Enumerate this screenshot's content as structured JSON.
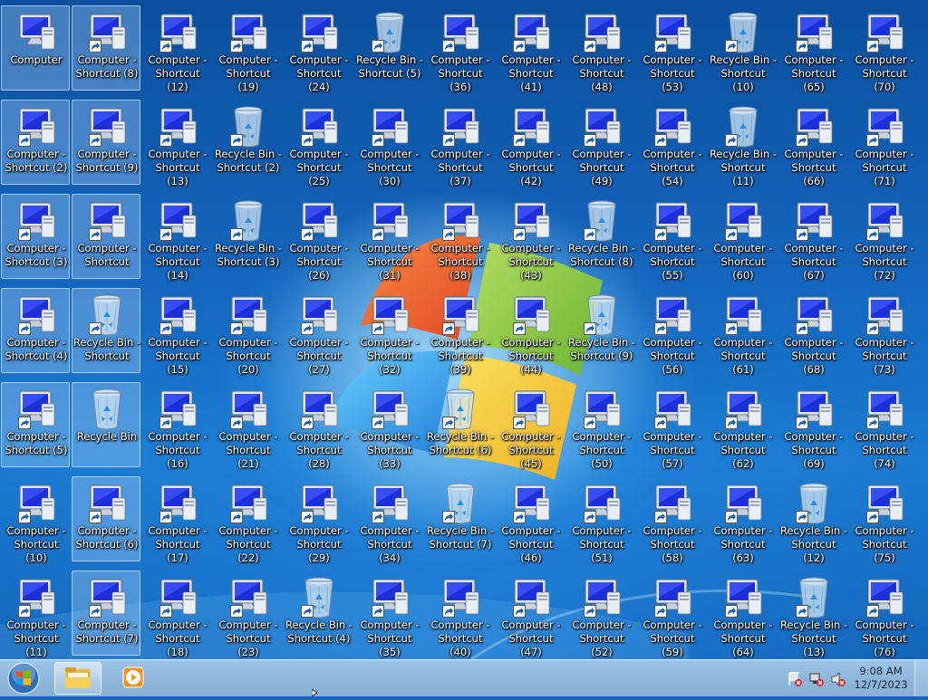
{
  "desktop": {
    "columns": [
      [
        {
          "label": "Computer",
          "icon": "computer-icon",
          "shortcut": false,
          "selected": true
        },
        {
          "label": "Computer - Shortcut (2)",
          "icon": "computer-icon",
          "shortcut": true,
          "selected": true
        },
        {
          "label": "Computer - Shortcut (3)",
          "icon": "computer-icon",
          "shortcut": true,
          "selected": true
        },
        {
          "label": "Computer - Shortcut (4)",
          "icon": "computer-icon",
          "shortcut": true,
          "selected": true
        },
        {
          "label": "Computer - Shortcut (5)",
          "icon": "computer-icon",
          "shortcut": true,
          "selected": true
        },
        {
          "label": "Computer - Shortcut (10)",
          "icon": "computer-icon",
          "shortcut": true,
          "selected": false
        },
        {
          "label": "Computer - Shortcut (11)",
          "icon": "computer-icon",
          "shortcut": true,
          "selected": false
        }
      ],
      [
        {
          "label": "Computer - Shortcut (8)",
          "icon": "computer-icon",
          "shortcut": true,
          "selected": true
        },
        {
          "label": "Computer - Shortcut (9)",
          "icon": "computer-icon",
          "shortcut": true,
          "selected": true
        },
        {
          "label": "Computer - Shortcut",
          "icon": "computer-icon",
          "shortcut": true,
          "selected": true
        },
        {
          "label": "Recycle Bin - Shortcut",
          "icon": "recycle-bin-icon",
          "shortcut": true,
          "selected": true
        },
        {
          "label": "Recycle Bin",
          "icon": "recycle-bin-icon",
          "shortcut": false,
          "selected": true
        },
        {
          "label": "Computer - Shortcut (6)",
          "icon": "computer-icon",
          "shortcut": true,
          "selected": true
        },
        {
          "label": "Computer - Shortcut (7)",
          "icon": "computer-icon",
          "shortcut": true,
          "selected": true
        }
      ],
      [
        {
          "label": "Computer - Shortcut (12)",
          "icon": "computer-icon",
          "shortcut": true,
          "selected": false
        },
        {
          "label": "Computer - Shortcut (13)",
          "icon": "computer-icon",
          "shortcut": true,
          "selected": false
        },
        {
          "label": "Computer - Shortcut (14)",
          "icon": "computer-icon",
          "shortcut": true,
          "selected": false
        },
        {
          "label": "Computer - Shortcut (15)",
          "icon": "computer-icon",
          "shortcut": true,
          "selected": false
        },
        {
          "label": "Computer - Shortcut (16)",
          "icon": "computer-icon",
          "shortcut": true,
          "selected": false
        },
        {
          "label": "Computer - Shortcut (17)",
          "icon": "computer-icon",
          "shortcut": true,
          "selected": false
        },
        {
          "label": "Computer - Shortcut (18)",
          "icon": "computer-icon",
          "shortcut": true,
          "selected": false
        }
      ],
      [
        {
          "label": "Computer - Shortcut (19)",
          "icon": "computer-icon",
          "shortcut": true,
          "selected": false
        },
        {
          "label": "Recycle Bin - Shortcut (2)",
          "icon": "recycle-bin-icon",
          "shortcut": true,
          "selected": false
        },
        {
          "label": "Recycle Bin - Shortcut (3)",
          "icon": "recycle-bin-icon",
          "shortcut": true,
          "selected": false
        },
        {
          "label": "Computer - Shortcut (20)",
          "icon": "computer-icon",
          "shortcut": true,
          "selected": false
        },
        {
          "label": "Computer - Shortcut (21)",
          "icon": "computer-icon",
          "shortcut": true,
          "selected": false
        },
        {
          "label": "Computer - Shortcut (22)",
          "icon": "computer-icon",
          "shortcut": true,
          "selected": false
        },
        {
          "label": "Computer - Shortcut (23)",
          "icon": "computer-icon",
          "shortcut": true,
          "selected": false
        }
      ],
      [
        {
          "label": "Computer - Shortcut (24)",
          "icon": "computer-icon",
          "shortcut": true,
          "selected": false
        },
        {
          "label": "Computer - Shortcut (25)",
          "icon": "computer-icon",
          "shortcut": true,
          "selected": false
        },
        {
          "label": "Computer - Shortcut (26)",
          "icon": "computer-icon",
          "shortcut": true,
          "selected": false
        },
        {
          "label": "Computer - Shortcut (27)",
          "icon": "computer-icon",
          "shortcut": true,
          "selected": false
        },
        {
          "label": "Computer - Shortcut (28)",
          "icon": "computer-icon",
          "shortcut": true,
          "selected": false
        },
        {
          "label": "Computer - Shortcut (29)",
          "icon": "computer-icon",
          "shortcut": true,
          "selected": false
        },
        {
          "label": "Recycle Bin - Shortcut (4)",
          "icon": "recycle-bin-icon",
          "shortcut": true,
          "selected": false
        }
      ],
      [
        {
          "label": "Recycle Bin - Shortcut (5)",
          "icon": "recycle-bin-icon",
          "shortcut": true,
          "selected": false
        },
        {
          "label": "Computer - Shortcut (30)",
          "icon": "computer-icon",
          "shortcut": true,
          "selected": false
        },
        {
          "label": "Computer - Shortcut (31)",
          "icon": "computer-icon",
          "shortcut": true,
          "selected": false
        },
        {
          "label": "Computer - Shortcut (32)",
          "icon": "computer-icon",
          "shortcut": true,
          "selected": false
        },
        {
          "label": "Computer - Shortcut (33)",
          "icon": "computer-icon",
          "shortcut": true,
          "selected": false
        },
        {
          "label": "Computer - Shortcut (34)",
          "icon": "computer-icon",
          "shortcut": true,
          "selected": false
        },
        {
          "label": "Computer - Shortcut (35)",
          "icon": "computer-icon",
          "shortcut": true,
          "selected": false
        }
      ],
      [
        {
          "label": "Computer - Shortcut (36)",
          "icon": "computer-icon",
          "shortcut": true,
          "selected": false
        },
        {
          "label": "Computer - Shortcut (37)",
          "icon": "computer-icon",
          "shortcut": true,
          "selected": false
        },
        {
          "label": "Computer - Shortcut (38)",
          "icon": "computer-icon",
          "shortcut": true,
          "selected": false
        },
        {
          "label": "Computer - Shortcut (39)",
          "icon": "computer-icon",
          "shortcut": true,
          "selected": false
        },
        {
          "label": "Recycle Bin - Shortcut (6)",
          "icon": "recycle-bin-icon",
          "shortcut": true,
          "selected": false
        },
        {
          "label": "Recycle Bin - Shortcut (7)",
          "icon": "recycle-bin-icon",
          "shortcut": true,
          "selected": false
        },
        {
          "label": "Computer - Shortcut (40)",
          "icon": "computer-icon",
          "shortcut": true,
          "selected": false
        }
      ],
      [
        {
          "label": "Computer - Shortcut (41)",
          "icon": "computer-icon",
          "shortcut": true,
          "selected": false
        },
        {
          "label": "Computer - Shortcut (42)",
          "icon": "computer-icon",
          "shortcut": true,
          "selected": false
        },
        {
          "label": "Computer - Shortcut (43)",
          "icon": "computer-icon",
          "shortcut": true,
          "selected": false
        },
        {
          "label": "Computer - Shortcut (44)",
          "icon": "computer-icon",
          "shortcut": true,
          "selected": false
        },
        {
          "label": "Computer - Shortcut (45)",
          "icon": "computer-icon",
          "shortcut": true,
          "selected": false
        },
        {
          "label": "Computer - Shortcut (46)",
          "icon": "computer-icon",
          "shortcut": true,
          "selected": false
        },
        {
          "label": "Computer - Shortcut (47)",
          "icon": "computer-icon",
          "shortcut": true,
          "selected": false
        }
      ],
      [
        {
          "label": "Computer - Shortcut (48)",
          "icon": "computer-icon",
          "shortcut": true,
          "selected": false
        },
        {
          "label": "Computer - Shortcut (49)",
          "icon": "computer-icon",
          "shortcut": true,
          "selected": false
        },
        {
          "label": "Recycle Bin - Shortcut (8)",
          "icon": "recycle-bin-icon",
          "shortcut": true,
          "selected": false
        },
        {
          "label": "Recycle Bin - Shortcut (9)",
          "icon": "recycle-bin-icon",
          "shortcut": true,
          "selected": false
        },
        {
          "label": "Computer - Shortcut (50)",
          "icon": "computer-icon",
          "shortcut": true,
          "selected": false
        },
        {
          "label": "Computer - Shortcut (51)",
          "icon": "computer-icon",
          "shortcut": true,
          "selected": false
        },
        {
          "label": "Computer - Shortcut (52)",
          "icon": "computer-icon",
          "shortcut": true,
          "selected": false
        }
      ],
      [
        {
          "label": "Computer - Shortcut (53)",
          "icon": "computer-icon",
          "shortcut": true,
          "selected": false
        },
        {
          "label": "Computer - Shortcut (54)",
          "icon": "computer-icon",
          "shortcut": true,
          "selected": false
        },
        {
          "label": "Computer - Shortcut (55)",
          "icon": "computer-icon",
          "shortcut": true,
          "selected": false
        },
        {
          "label": "Computer - Shortcut (56)",
          "icon": "computer-icon",
          "shortcut": true,
          "selected": false
        },
        {
          "label": "Computer - Shortcut (57)",
          "icon": "computer-icon",
          "shortcut": true,
          "selected": false
        },
        {
          "label": "Computer - Shortcut (58)",
          "icon": "computer-icon",
          "shortcut": true,
          "selected": false
        },
        {
          "label": "Computer - Shortcut (59)",
          "icon": "computer-icon",
          "shortcut": true,
          "selected": false
        }
      ],
      [
        {
          "label": "Recycle Bin - Shortcut (10)",
          "icon": "recycle-bin-icon",
          "shortcut": true,
          "selected": false
        },
        {
          "label": "Recycle Bin - Shortcut (11)",
          "icon": "recycle-bin-icon",
          "shortcut": true,
          "selected": false
        },
        {
          "label": "Computer - Shortcut (60)",
          "icon": "computer-icon",
          "shortcut": true,
          "selected": false
        },
        {
          "label": "Computer - Shortcut (61)",
          "icon": "computer-icon",
          "shortcut": true,
          "selected": false
        },
        {
          "label": "Computer - Shortcut (62)",
          "icon": "computer-icon",
          "shortcut": true,
          "selected": false
        },
        {
          "label": "Computer - Shortcut (63)",
          "icon": "computer-icon",
          "shortcut": true,
          "selected": false
        },
        {
          "label": "Computer - Shortcut (64)",
          "icon": "computer-icon",
          "shortcut": true,
          "selected": false
        }
      ],
      [
        {
          "label": "Computer - Shortcut (65)",
          "icon": "computer-icon",
          "shortcut": true,
          "selected": false
        },
        {
          "label": "Computer - Shortcut (66)",
          "icon": "computer-icon",
          "shortcut": true,
          "selected": false
        },
        {
          "label": "Computer - Shortcut (67)",
          "icon": "computer-icon",
          "shortcut": true,
          "selected": false
        },
        {
          "label": "Computer - Shortcut (68)",
          "icon": "computer-icon",
          "shortcut": true,
          "selected": false
        },
        {
          "label": "Computer - Shortcut (69)",
          "icon": "computer-icon",
          "shortcut": true,
          "selected": false
        },
        {
          "label": "Recycle Bin - Shortcut (12)",
          "icon": "recycle-bin-icon",
          "shortcut": true,
          "selected": false
        },
        {
          "label": "Recycle Bin - Shortcut (13)",
          "icon": "recycle-bin-icon",
          "shortcut": true,
          "selected": false
        }
      ],
      [
        {
          "label": "Computer - Shortcut (70)",
          "icon": "computer-icon",
          "shortcut": true,
          "selected": false
        },
        {
          "label": "Computer - Shortcut (71)",
          "icon": "computer-icon",
          "shortcut": true,
          "selected": false
        },
        {
          "label": "Computer - Shortcut (72)",
          "icon": "computer-icon",
          "shortcut": true,
          "selected": false
        },
        {
          "label": "Computer - Shortcut (73)",
          "icon": "computer-icon",
          "shortcut": true,
          "selected": false
        },
        {
          "label": "Computer - Shortcut (74)",
          "icon": "computer-icon",
          "shortcut": true,
          "selected": false
        },
        {
          "label": "Computer - Shortcut (75)",
          "icon": "computer-icon",
          "shortcut": true,
          "selected": false
        },
        {
          "label": "Computer - Shortcut (76)",
          "icon": "computer-icon",
          "shortcut": true,
          "selected": false
        }
      ]
    ]
  },
  "taskbar": {
    "start_icon": "windows-orb-icon",
    "pinned": [
      {
        "name": "windows-explorer",
        "icon": "folder-icon",
        "active": true
      },
      {
        "name": "windows-media-player",
        "icon": "media-player-icon",
        "active": false
      }
    ],
    "tray_icons": [
      "action-center-icon",
      "network-icon",
      "volume-icon"
    ],
    "clock": {
      "time": "9:08 AM",
      "date": "12/7/2023"
    }
  }
}
